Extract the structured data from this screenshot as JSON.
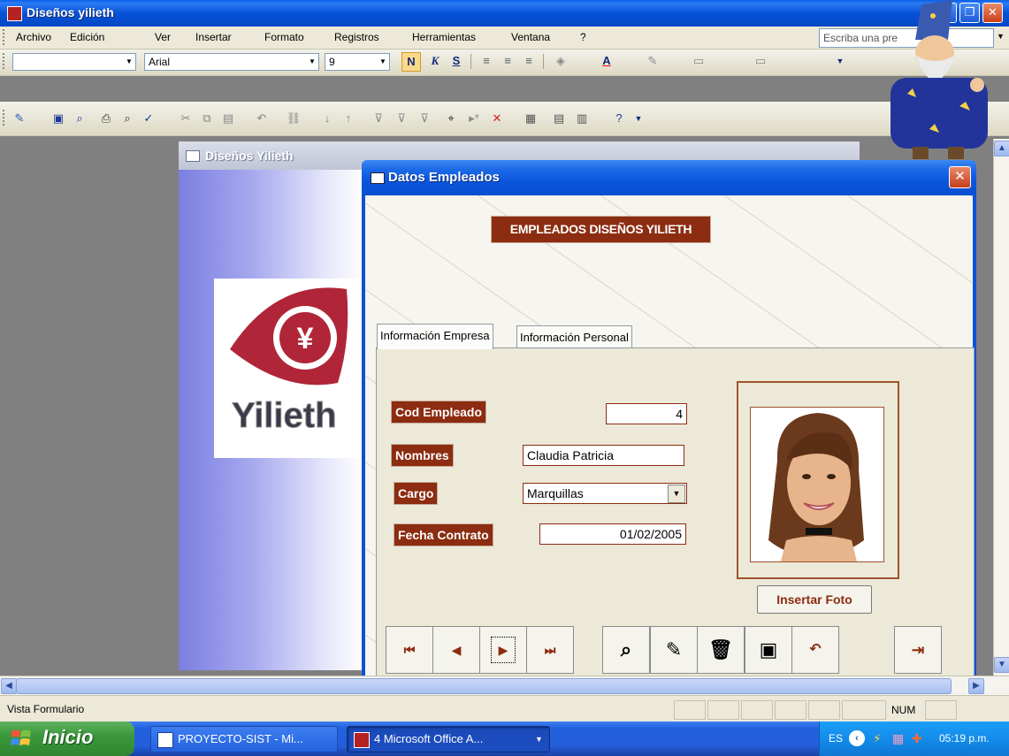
{
  "app": {
    "title": "Diseños yilieth"
  },
  "menu": {
    "items": [
      "Archivo",
      "Edición",
      "Ver",
      "Insertar",
      "Formato",
      "Registros",
      "Herramientas",
      "Ventana",
      "?"
    ],
    "ask_placeholder": "Escriba una pre"
  },
  "format_toolbar": {
    "font": "Arial",
    "size": "9",
    "bold": "N",
    "italic": "K",
    "underline": "S"
  },
  "background_form": {
    "title": "Diseños Yilieth",
    "logo_text": "Yilieth"
  },
  "dialog": {
    "title": "Datos Empleados",
    "heading": "EMPLEADOS DISEÑOS YILIETH",
    "tabs": [
      "Información Empresa",
      "Información Personal"
    ],
    "fields": {
      "cod_label": "Cod Empleado",
      "cod_value": "4",
      "nombres_label": "Nombres",
      "nombres_value": "Claudia Patricia",
      "cargo_label": "Cargo",
      "cargo_value": "Marquillas",
      "fecha_label": "Fecha Contrato",
      "fecha_value": "01/02/2005"
    },
    "insert_photo": "Insertar Foto"
  },
  "status": {
    "text": "Vista Formulario",
    "num": "NUM"
  },
  "taskbar": {
    "start": "Inicio",
    "tasks": [
      "PROYECTO-SIST - Mi...",
      "4 Microsoft Office A..."
    ],
    "lang": "ES",
    "clock": "05:19 p.m."
  },
  "colors": {
    "accent_brown": "#8c2c10",
    "title_blue": "#0a55dc",
    "taskbar_blue": "#245edb",
    "start_green": "#3c983c"
  }
}
